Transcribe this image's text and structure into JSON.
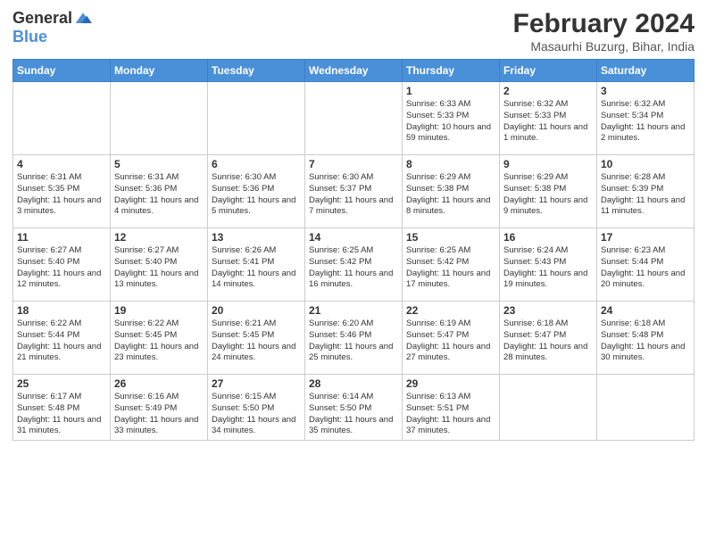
{
  "logo": {
    "general": "General",
    "blue": "Blue"
  },
  "title": {
    "month_year": "February 2024",
    "location": "Masaurhi Buzurg, Bihar, India"
  },
  "days_of_week": [
    "Sunday",
    "Monday",
    "Tuesday",
    "Wednesday",
    "Thursday",
    "Friday",
    "Saturday"
  ],
  "weeks": [
    [
      {
        "day": "",
        "info": ""
      },
      {
        "day": "",
        "info": ""
      },
      {
        "day": "",
        "info": ""
      },
      {
        "day": "",
        "info": ""
      },
      {
        "day": "1",
        "info": "Sunrise: 6:33 AM\nSunset: 5:33 PM\nDaylight: 10 hours and 59 minutes."
      },
      {
        "day": "2",
        "info": "Sunrise: 6:32 AM\nSunset: 5:33 PM\nDaylight: 11 hours and 1 minute."
      },
      {
        "day": "3",
        "info": "Sunrise: 6:32 AM\nSunset: 5:34 PM\nDaylight: 11 hours and 2 minutes."
      }
    ],
    [
      {
        "day": "4",
        "info": "Sunrise: 6:31 AM\nSunset: 5:35 PM\nDaylight: 11 hours and 3 minutes."
      },
      {
        "day": "5",
        "info": "Sunrise: 6:31 AM\nSunset: 5:36 PM\nDaylight: 11 hours and 4 minutes."
      },
      {
        "day": "6",
        "info": "Sunrise: 6:30 AM\nSunset: 5:36 PM\nDaylight: 11 hours and 5 minutes."
      },
      {
        "day": "7",
        "info": "Sunrise: 6:30 AM\nSunset: 5:37 PM\nDaylight: 11 hours and 7 minutes."
      },
      {
        "day": "8",
        "info": "Sunrise: 6:29 AM\nSunset: 5:38 PM\nDaylight: 11 hours and 8 minutes."
      },
      {
        "day": "9",
        "info": "Sunrise: 6:29 AM\nSunset: 5:38 PM\nDaylight: 11 hours and 9 minutes."
      },
      {
        "day": "10",
        "info": "Sunrise: 6:28 AM\nSunset: 5:39 PM\nDaylight: 11 hours and 11 minutes."
      }
    ],
    [
      {
        "day": "11",
        "info": "Sunrise: 6:27 AM\nSunset: 5:40 PM\nDaylight: 11 hours and 12 minutes."
      },
      {
        "day": "12",
        "info": "Sunrise: 6:27 AM\nSunset: 5:40 PM\nDaylight: 11 hours and 13 minutes."
      },
      {
        "day": "13",
        "info": "Sunrise: 6:26 AM\nSunset: 5:41 PM\nDaylight: 11 hours and 14 minutes."
      },
      {
        "day": "14",
        "info": "Sunrise: 6:25 AM\nSunset: 5:42 PM\nDaylight: 11 hours and 16 minutes."
      },
      {
        "day": "15",
        "info": "Sunrise: 6:25 AM\nSunset: 5:42 PM\nDaylight: 11 hours and 17 minutes."
      },
      {
        "day": "16",
        "info": "Sunrise: 6:24 AM\nSunset: 5:43 PM\nDaylight: 11 hours and 19 minutes."
      },
      {
        "day": "17",
        "info": "Sunrise: 6:23 AM\nSunset: 5:44 PM\nDaylight: 11 hours and 20 minutes."
      }
    ],
    [
      {
        "day": "18",
        "info": "Sunrise: 6:22 AM\nSunset: 5:44 PM\nDaylight: 11 hours and 21 minutes."
      },
      {
        "day": "19",
        "info": "Sunrise: 6:22 AM\nSunset: 5:45 PM\nDaylight: 11 hours and 23 minutes."
      },
      {
        "day": "20",
        "info": "Sunrise: 6:21 AM\nSunset: 5:45 PM\nDaylight: 11 hours and 24 minutes."
      },
      {
        "day": "21",
        "info": "Sunrise: 6:20 AM\nSunset: 5:46 PM\nDaylight: 11 hours and 25 minutes."
      },
      {
        "day": "22",
        "info": "Sunrise: 6:19 AM\nSunset: 5:47 PM\nDaylight: 11 hours and 27 minutes."
      },
      {
        "day": "23",
        "info": "Sunrise: 6:18 AM\nSunset: 5:47 PM\nDaylight: 11 hours and 28 minutes."
      },
      {
        "day": "24",
        "info": "Sunrise: 6:18 AM\nSunset: 5:48 PM\nDaylight: 11 hours and 30 minutes."
      }
    ],
    [
      {
        "day": "25",
        "info": "Sunrise: 6:17 AM\nSunset: 5:48 PM\nDaylight: 11 hours and 31 minutes."
      },
      {
        "day": "26",
        "info": "Sunrise: 6:16 AM\nSunset: 5:49 PM\nDaylight: 11 hours and 33 minutes."
      },
      {
        "day": "27",
        "info": "Sunrise: 6:15 AM\nSunset: 5:50 PM\nDaylight: 11 hours and 34 minutes."
      },
      {
        "day": "28",
        "info": "Sunrise: 6:14 AM\nSunset: 5:50 PM\nDaylight: 11 hours and 35 minutes."
      },
      {
        "day": "29",
        "info": "Sunrise: 6:13 AM\nSunset: 5:51 PM\nDaylight: 11 hours and 37 minutes."
      },
      {
        "day": "",
        "info": ""
      },
      {
        "day": "",
        "info": ""
      }
    ]
  ]
}
